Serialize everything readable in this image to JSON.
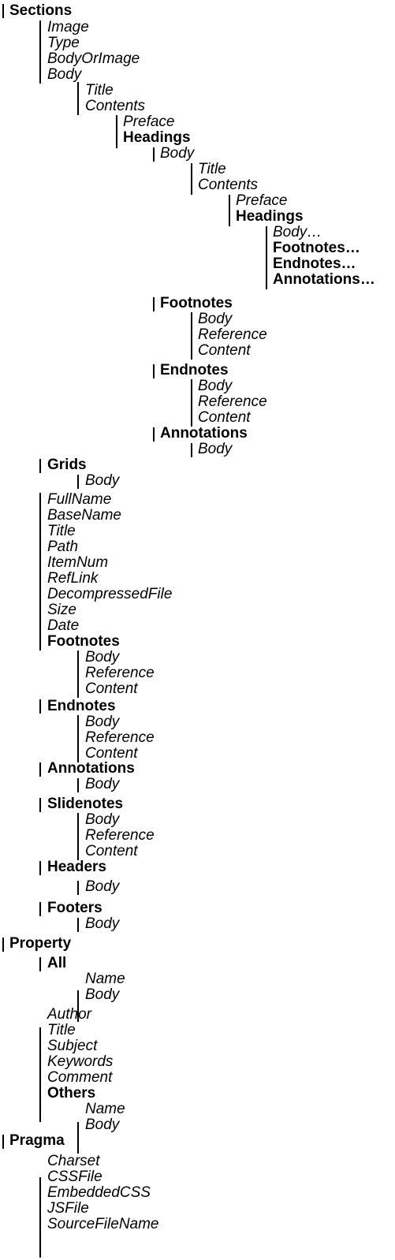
{
  "tree": {
    "sections": {
      "label": "Sections",
      "image": "Image",
      "type": "Type",
      "body_or_image": "BodyOrImage",
      "body": "Body",
      "body_children": {
        "title": "Title",
        "contents": "Contents",
        "preface": "Preface",
        "headings": "Headings",
        "headings_children": {
          "body": "Body",
          "title": "Title",
          "contents": "Contents",
          "preface": "Preface",
          "headings": "Headings",
          "more_body": "Body…",
          "more_footnotes": "Footnotes…",
          "more_endnotes": "Endnotes…",
          "more_annotations": "Annotations…"
        },
        "footnotes": {
          "label": "Footnotes",
          "items": [
            "Body",
            "Reference",
            "Content"
          ]
        },
        "endnotes": {
          "label": "Endnotes",
          "items": [
            "Body",
            "Reference",
            "Content"
          ]
        },
        "annotations": {
          "label": "Annotations",
          "items": [
            "Body"
          ]
        }
      },
      "grids": {
        "label": "Grids",
        "items": [
          "Body"
        ]
      },
      "file_props": [
        "FullName",
        "BaseName",
        "Title",
        "Path",
        "ItemNum",
        "RefLink",
        "DecompressedFile",
        "Size",
        "Date"
      ],
      "footnotes": {
        "label": "Footnotes",
        "items": [
          "Body",
          "Reference",
          "Content"
        ]
      },
      "endnotes": {
        "label": "Endnotes",
        "items": [
          "Body",
          "Reference",
          "Content"
        ]
      },
      "annotations": {
        "label": "Annotations",
        "items": [
          "Body"
        ]
      },
      "slidenotes": {
        "label": "Slidenotes",
        "items": [
          "Body",
          "Reference",
          "Content"
        ]
      },
      "headers": {
        "label": "Headers",
        "items": [
          "Body"
        ]
      },
      "footers": {
        "label": "Footers",
        "items": [
          "Body"
        ]
      }
    },
    "property": {
      "label": "Property",
      "all": {
        "label": "All",
        "items": [
          "Name",
          "Body"
        ]
      },
      "items": [
        "Author",
        "Title",
        "Subject",
        "Keywords",
        "Comment"
      ],
      "others": {
        "label": "Others",
        "items": [
          "Name",
          "Body"
        ]
      }
    },
    "pragma": {
      "label": "Pragma",
      "items": [
        "Charset",
        "CSSFile",
        "EmbeddedCSS",
        "JSFile",
        "SourceFileName"
      ]
    }
  }
}
